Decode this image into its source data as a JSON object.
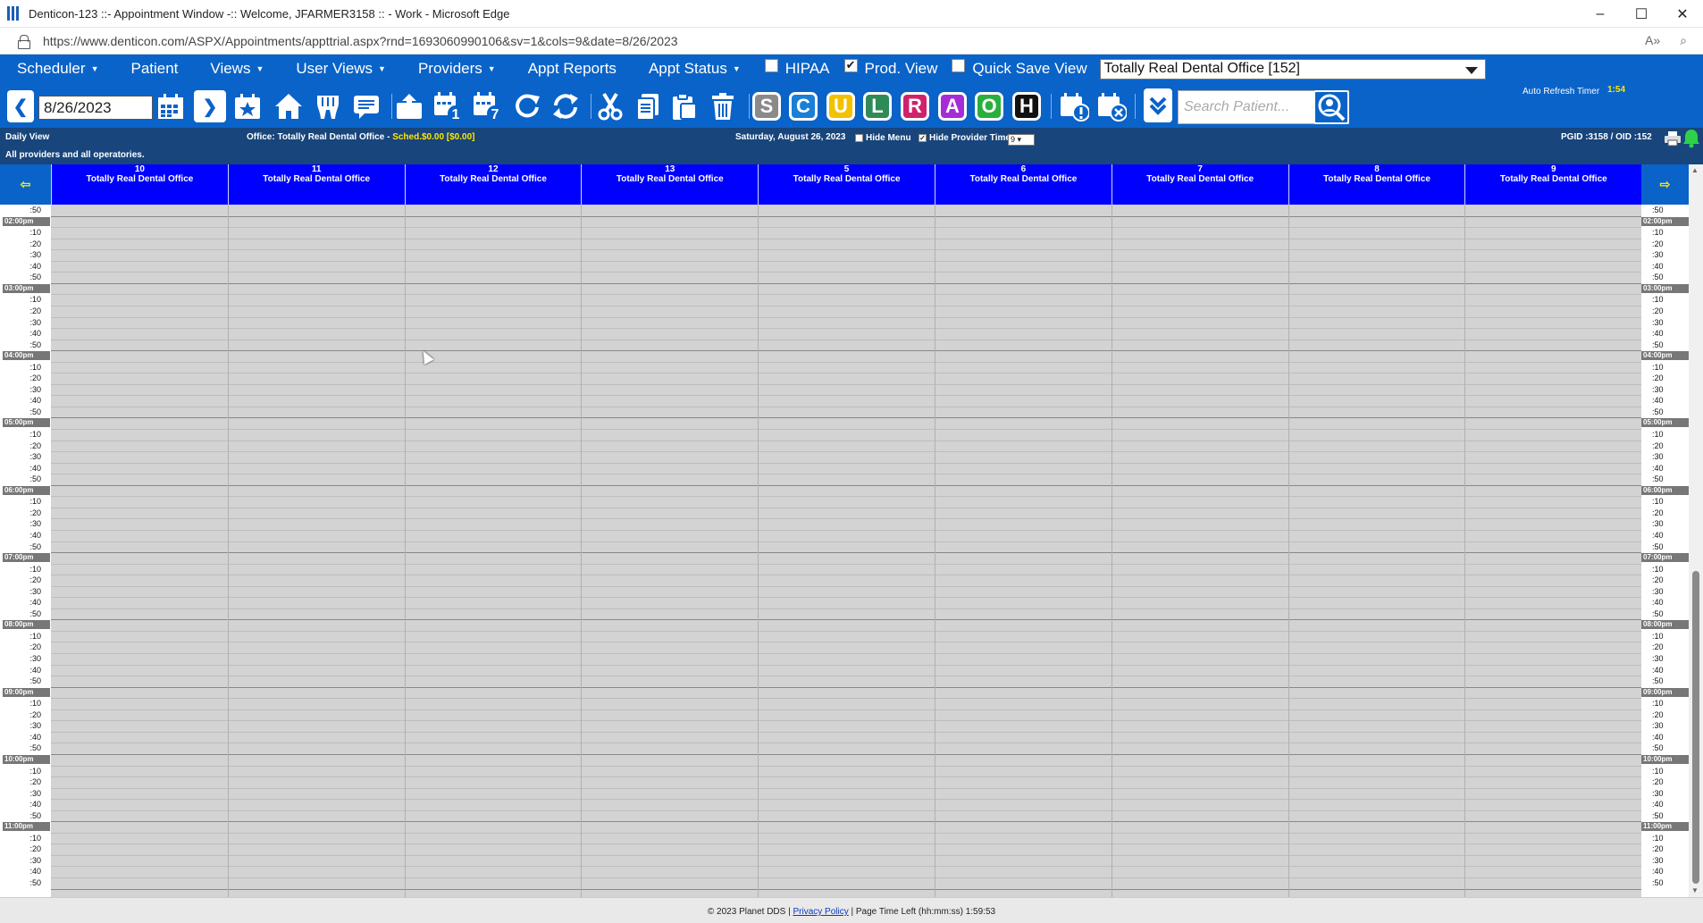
{
  "window": {
    "title": "Denticon-123 ::- Appointment Window -:: Welcome, JFARMER3158 :: - Work - Microsoft Edge",
    "minimize": "–",
    "maximize": "☐",
    "close": "✕"
  },
  "address": {
    "url": "https://www.denticon.com/ASPX/Appointments/appttrial.aspx?rnd=1693060990106&sv=1&cols=9&date=8/26/2023"
  },
  "menu": {
    "scheduler": "Scheduler",
    "patient": "Patient",
    "views": "Views",
    "user_views": "User Views",
    "providers": "Providers",
    "appt_reports": "Appt Reports",
    "appt_status": "Appt Status",
    "hipaa": "HIPAA",
    "hipaa_checked": false,
    "prod_view": "Prod. View",
    "prod_view_checked": true,
    "quick_save_view": "Quick Save View",
    "quick_save_checked": false,
    "office_selected": "Totally Real Dental Office [152]"
  },
  "toolbar": {
    "date_value": "8/26/2023",
    "status_letters": [
      {
        "letter": "S",
        "color": "#8a8a8a"
      },
      {
        "letter": "C",
        "color": "#1a7fd6"
      },
      {
        "letter": "U",
        "color": "#f2c200"
      },
      {
        "letter": "L",
        "color": "#2e8b57"
      },
      {
        "letter": "R",
        "color": "#d1216b"
      },
      {
        "letter": "A",
        "color": "#a52cd6"
      },
      {
        "letter": "O",
        "color": "#28b03c"
      },
      {
        "letter": "H",
        "color": "#111111"
      }
    ],
    "search_placeholder": "Search Patient...",
    "auto_refresh_label": "Auto Refresh Timer",
    "auto_refresh_value": "1:54"
  },
  "info": {
    "daily_view": "Daily View",
    "all_providers": "All providers and all operatories.",
    "office_label": "Office: Totally Real Dental Office - ",
    "sched_value": "Sched.$0.00 [$0.00]",
    "date_text": "Saturday, August 26, 2023",
    "hide_menu": "Hide Menu",
    "hide_menu_checked": false,
    "hide_provider_time": "Hide Provider Time",
    "hide_provider_time_checked": true,
    "cols_select": "9",
    "pgid": "PGID :3158 / OID :152"
  },
  "columns": [
    {
      "num": "10",
      "name": "Totally Real Dental Office"
    },
    {
      "num": "11",
      "name": "Totally Real Dental Office"
    },
    {
      "num": "12",
      "name": "Totally Real Dental Office"
    },
    {
      "num": "13",
      "name": "Totally Real Dental Office"
    },
    {
      "num": "5",
      "name": "Totally Real Dental Office"
    },
    {
      "num": "6",
      "name": "Totally Real Dental Office"
    },
    {
      "num": "7",
      "name": "Totally Real Dental Office"
    },
    {
      "num": "8",
      "name": "Totally Real Dental Office"
    },
    {
      "num": "9",
      "name": "Totally Real Dental Office"
    }
  ],
  "nav": {
    "prev_arrow": "⇦",
    "next_arrow": "⇨"
  },
  "times": {
    "first_minute": ":50",
    "hours": [
      "02:00pm",
      "03:00pm",
      "04:00pm",
      "05:00pm",
      "06:00pm",
      "07:00pm",
      "08:00pm",
      "09:00pm",
      "10:00pm",
      "11:00pm"
    ],
    "minutes": [
      ":10",
      ":20",
      ":30",
      ":40",
      ":50"
    ]
  },
  "footer": {
    "copyright": "© 2023 Planet DDS | ",
    "privacy": "Privacy Policy",
    "page_time": " |  Page Time Left (hh:mm:ss) 1:59:53"
  }
}
